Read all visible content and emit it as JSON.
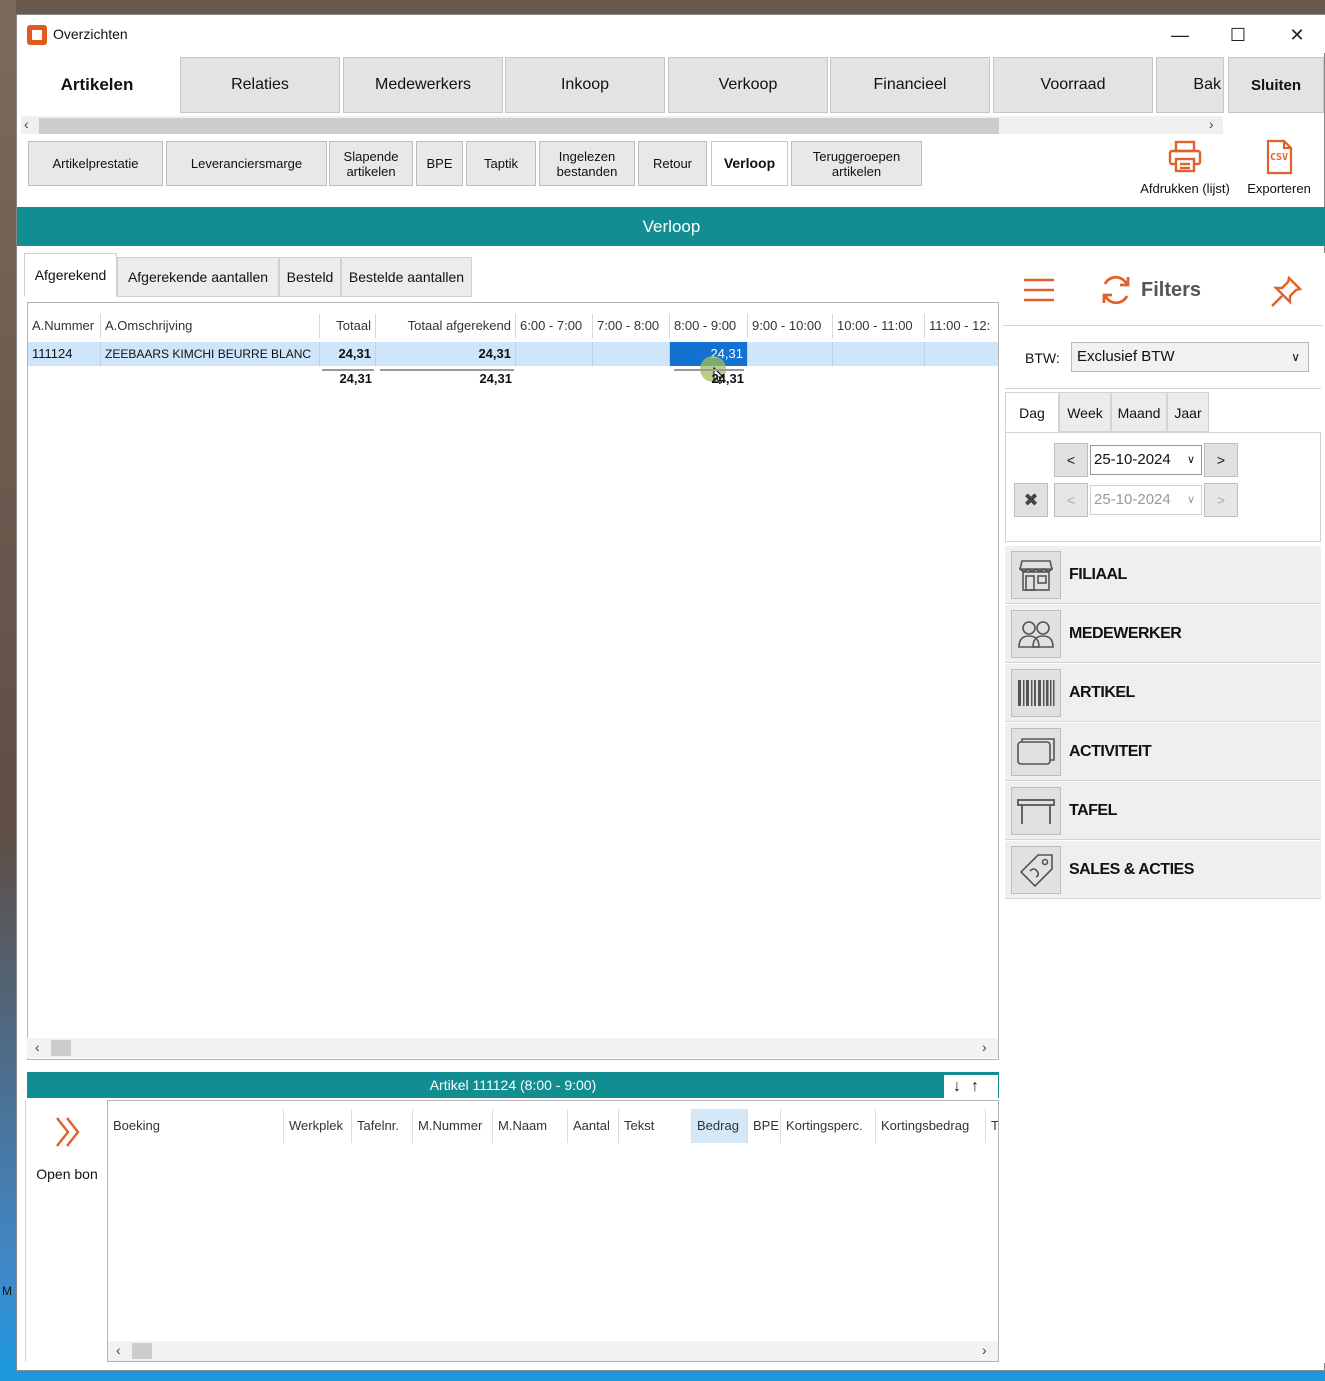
{
  "window": {
    "title": "Overzichten",
    "minimize": "—",
    "maximize": "☐",
    "close": "✕"
  },
  "main_tabs": [
    {
      "label": "Artikelen"
    },
    {
      "label": "Relaties"
    },
    {
      "label": "Medewerkers"
    },
    {
      "label": "Inkoop"
    },
    {
      "label": "Verkoop"
    },
    {
      "label": "Financieel"
    },
    {
      "label": "Voorraad"
    },
    {
      "label": "Bak"
    }
  ],
  "close_tab": "Sluiten",
  "sub_tabs": [
    {
      "label": "Artikelprestatie"
    },
    {
      "label": "Leveranciersmarge"
    },
    {
      "label": "Slapende artikelen"
    },
    {
      "label": "BPE"
    },
    {
      "label": "Taptik"
    },
    {
      "label": "Ingelezen bestanden"
    },
    {
      "label": "Retour"
    },
    {
      "label": "Verloop"
    },
    {
      "label": "Teruggeroepen artikelen"
    }
  ],
  "toolbar": {
    "print_label": "Afdrukken (lijst)",
    "export_label": "Exporteren",
    "export_icon_text": "CSV"
  },
  "banner": "Verloop",
  "grid_tabs": [
    {
      "label": "Afgerekend"
    },
    {
      "label": "Afgerekende aantallen"
    },
    {
      "label": "Besteld"
    },
    {
      "label": "Bestelde aantallen"
    }
  ],
  "grid": {
    "columns": [
      "A.Nummer",
      "A.Omschrijving",
      "Totaal",
      "Totaal afgerekend",
      "6:00 - 7:00",
      "7:00 - 8:00",
      "8:00 - 9:00",
      "9:00 - 10:00",
      "10:00 - 11:00",
      "11:00 - 12:"
    ],
    "rows": [
      {
        "nummer": "111124",
        "omschrijving": "ZEEBAARS KIMCHI BEURRE BLANC",
        "totaal": "24,31",
        "totaal_afgerekend": "24,31",
        "h6": "",
        "h7": "",
        "h8": "24,31",
        "h9": "",
        "h10": "",
        "h11": ""
      }
    ],
    "totals": {
      "totaal": "24,31",
      "totaal_afgerekend": "24,31",
      "h8": "24,31"
    }
  },
  "detail": {
    "title": "Artikel 111124 (8:00 - 9:00)",
    "open_bon": "Open bon",
    "columns": [
      "Boeking",
      "Werkplek",
      "Tafelnr.",
      "M.Nummer",
      "M.Naam",
      "Aantal",
      "Tekst",
      "Bedrag",
      "BPE",
      "Kortingsperc.",
      "Kortingsbedrag",
      "T"
    ]
  },
  "filters": {
    "title": "Filters",
    "btw_label": "BTW:",
    "btw_value": "Exclusief BTW",
    "period_tabs": [
      "Dag",
      "Week",
      "Maand",
      "Jaar"
    ],
    "date_from": "25-10-2024",
    "date_to": "25-10-2024",
    "prev": "<",
    "next": ">",
    "buttons": [
      {
        "label": "FILIAAL",
        "icon": "store-icon"
      },
      {
        "label": "MEDEWERKER",
        "icon": "users-icon"
      },
      {
        "label": "ARTIKEL",
        "icon": "barcode-icon"
      },
      {
        "label": "ACTIVITEIT",
        "icon": "cards-icon"
      },
      {
        "label": "TAFEL",
        "icon": "table-icon"
      },
      {
        "label": "SALES & ACTIES",
        "icon": "tag-icon"
      }
    ]
  },
  "colors": {
    "accent": "#128e93",
    "orange": "#e0622a",
    "selection": "#1372d1",
    "row_highlight": "#cfe6fa"
  }
}
